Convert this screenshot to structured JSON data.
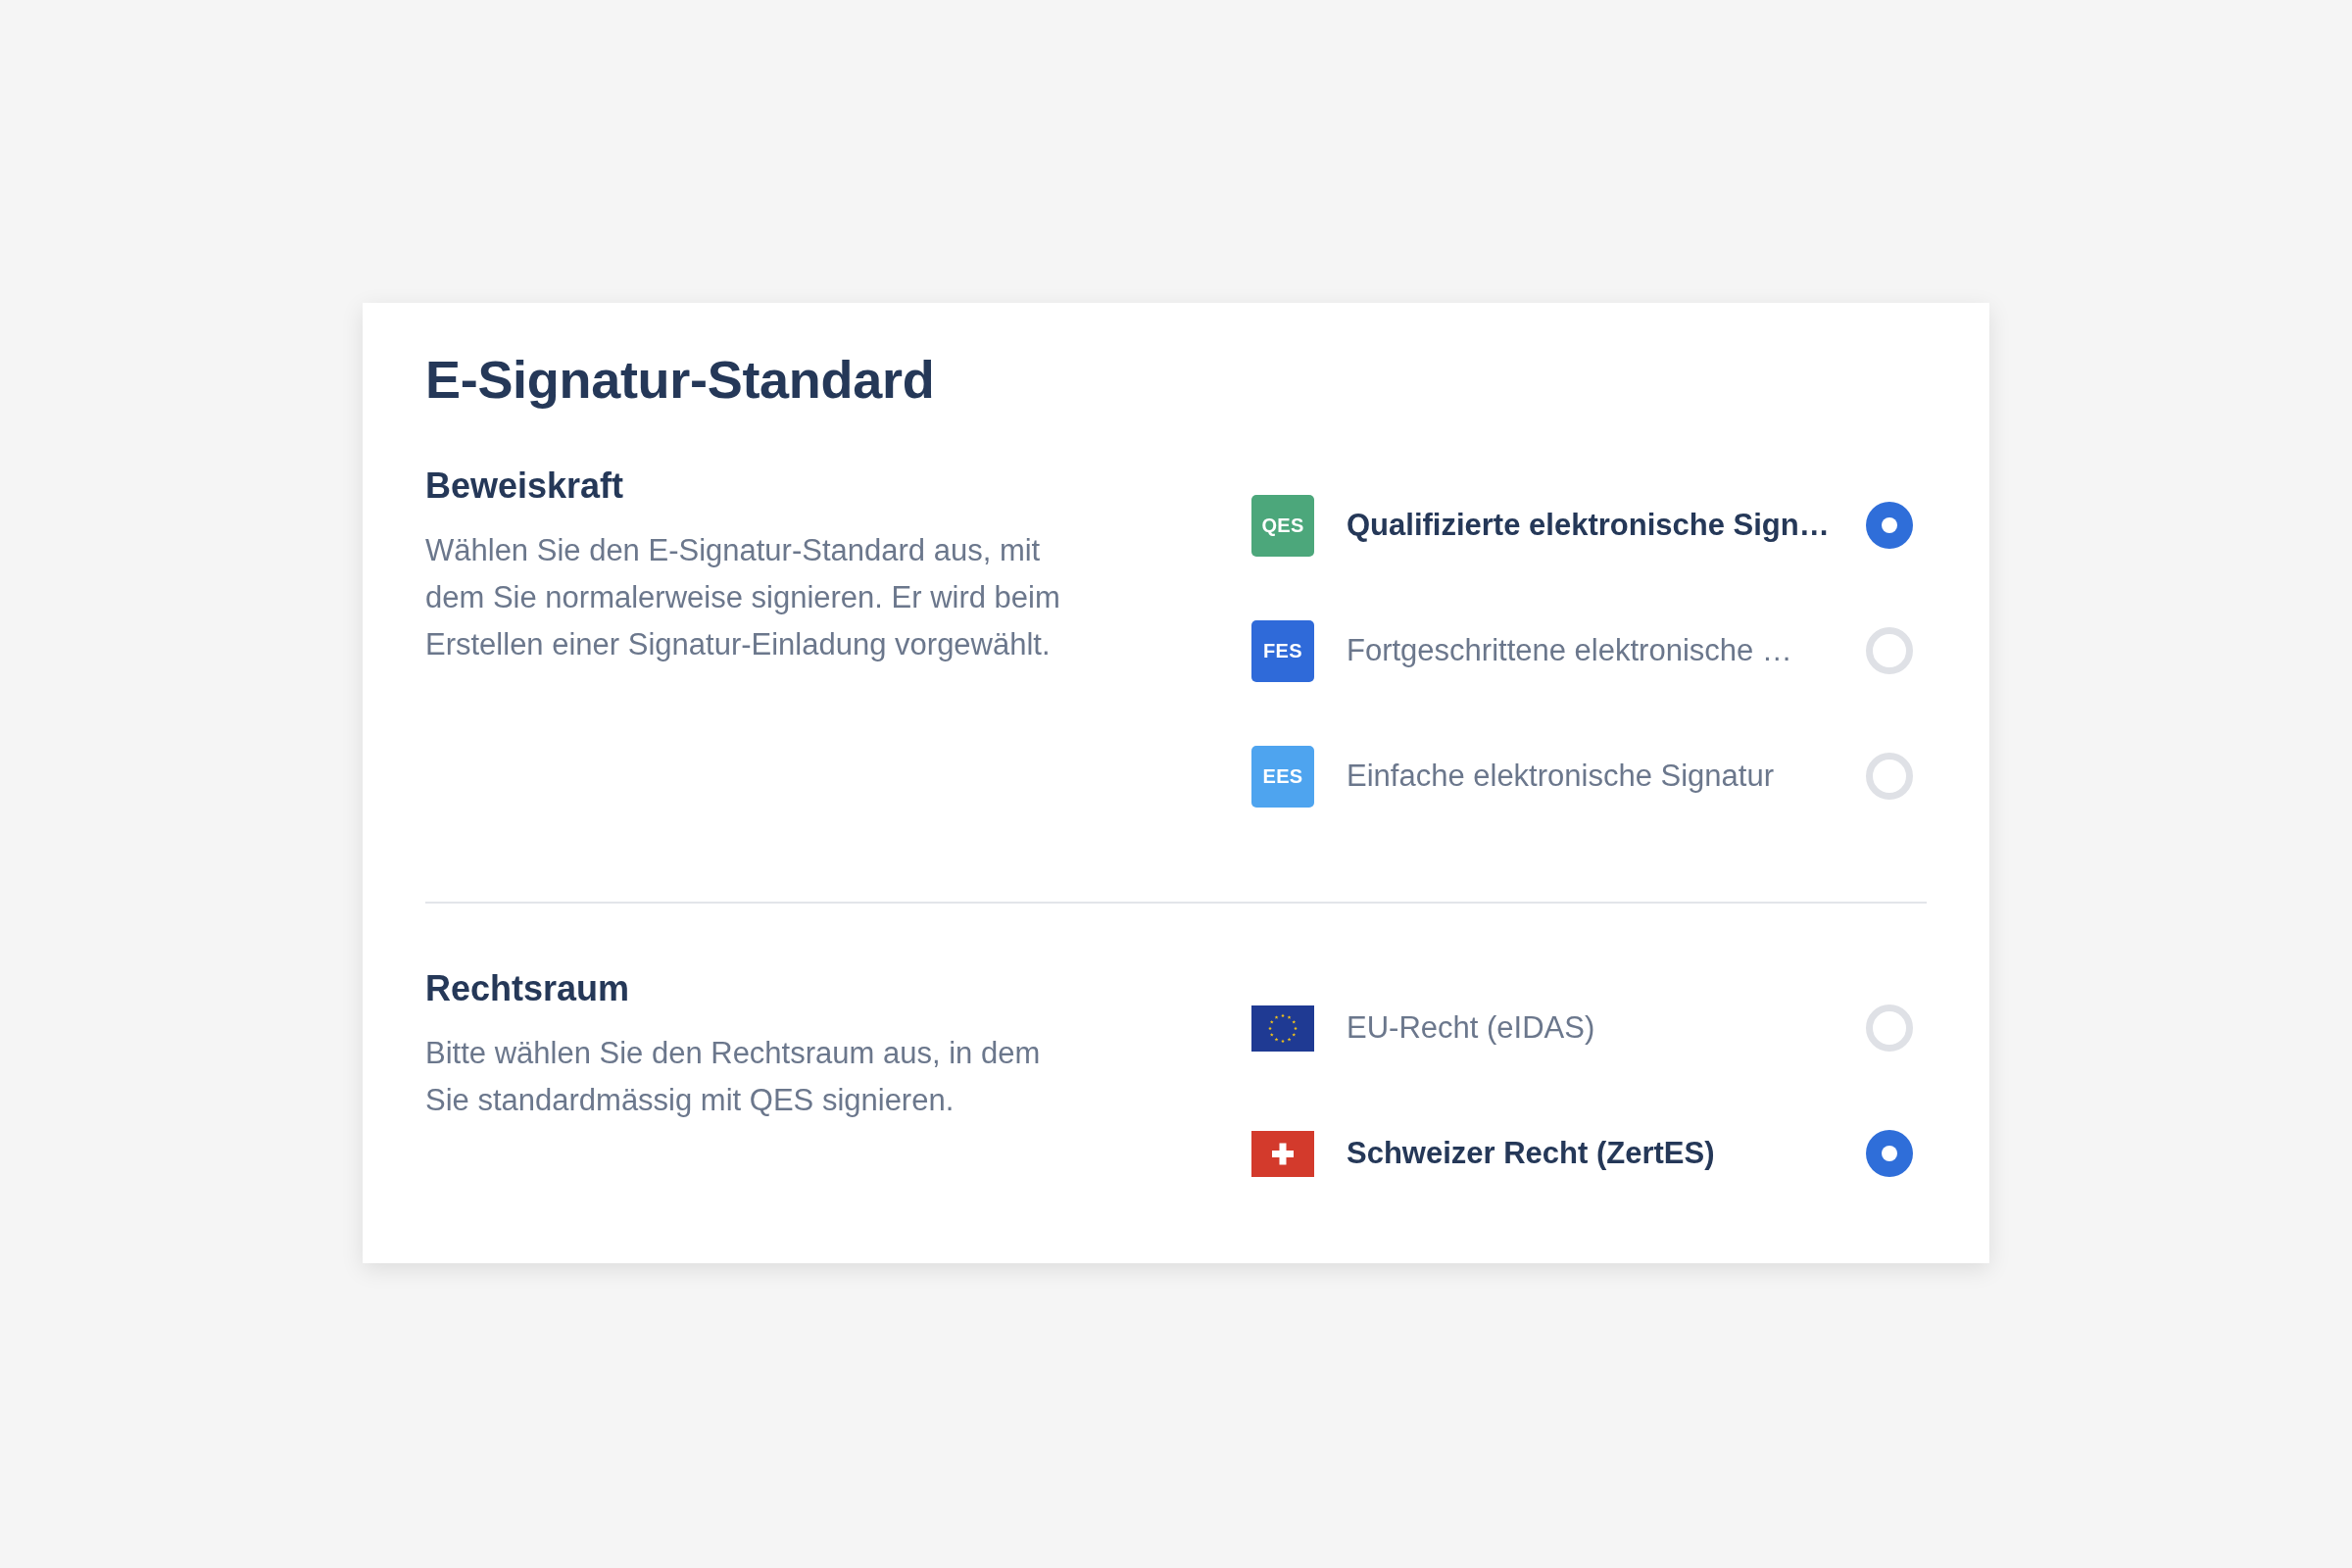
{
  "title": "E-Signatur-Standard",
  "sections": [
    {
      "heading": "Beweiskraft",
      "description": "Wählen Sie den E-Signatur-Standard aus, mit dem Sie normalerweise signieren. Er wird beim Erstellen einer Signatur-Einladung vorgewählt.",
      "options": [
        {
          "kind": "badge",
          "badge": "QES",
          "color": "#4ca77b",
          "label": "Qualifizierte elektronische Sign…",
          "selected": true
        },
        {
          "kind": "badge",
          "badge": "FES",
          "color": "#2f6ad9",
          "label": "Fortgeschrittene elektronische …",
          "selected": false
        },
        {
          "kind": "badge",
          "badge": "EES",
          "color": "#4ea4ef",
          "label": "Einfache elektronische Signatur",
          "selected": false
        }
      ]
    },
    {
      "heading": "Rechtsraum",
      "description": "Bitte wählen Sie den Rechtsraum aus, in dem Sie standardmässig mit QES signieren.",
      "options": [
        {
          "kind": "eu",
          "label": "EU-Recht (eIDAS)",
          "selected": false
        },
        {
          "kind": "swiss",
          "label": "Schweizer Recht (ZertES)",
          "selected": true
        }
      ]
    }
  ]
}
